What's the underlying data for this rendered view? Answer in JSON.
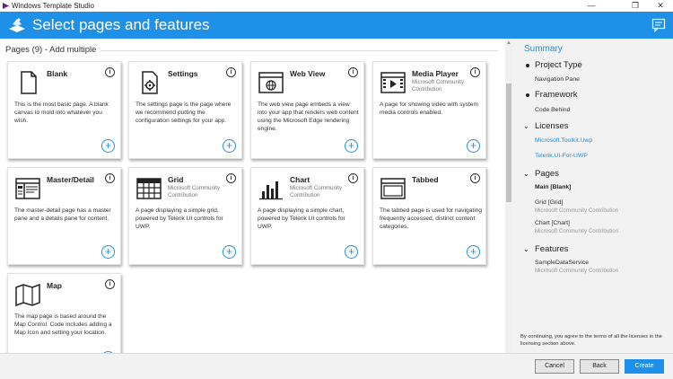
{
  "window": {
    "title": "Windows Template Studio",
    "controls": {
      "minimize": "—",
      "restore": "❐",
      "close": "✕"
    }
  },
  "header": {
    "title": "Select pages and features"
  },
  "section": {
    "title": "Pages (9) - Add multiple"
  },
  "cards": [
    {
      "name": "Blank",
      "sub": "",
      "icon": "blank-page-icon",
      "desc": "This is the most basic page. A blank canvas to mold into whatever you wish."
    },
    {
      "name": "Settings",
      "sub": "",
      "icon": "settings-gear-icon",
      "desc": "The settings page is the page where we recommend putting the configuration settings for your app."
    },
    {
      "name": "Web View",
      "sub": "",
      "icon": "web-view-globe-icon",
      "desc": "The web view page embeds a view into your app that renders web content using the Microsoft Edge rendering engine."
    },
    {
      "name": "Media Player",
      "sub": "Microsoft Community Contribution",
      "icon": "media-player-icon",
      "desc": "A page for showing video with system media controls enabled."
    },
    {
      "name": "Master/Detail",
      "sub": "",
      "icon": "master-detail-icon",
      "desc": "The master-detail page has a master pane and a details pane for content."
    },
    {
      "name": "Grid",
      "sub": "Microsoft Community Contribution",
      "icon": "grid-icon",
      "desc": "A page displaying a simple grid, powered by Telerik UI controls for UWP."
    },
    {
      "name": "Chart",
      "sub": "Microsoft Community Contribution",
      "icon": "chart-icon",
      "desc": "A page displaying a simple chart, powered by Telerik UI controls for UWP."
    },
    {
      "name": "Tabbed",
      "sub": "",
      "icon": "tabbed-icon",
      "desc": "The tabbed page is used for navigating frequently accessed, distinct content categories."
    },
    {
      "name": "Map",
      "sub": "",
      "icon": "map-icon",
      "desc": "The map page is based around the Map Control. Code includes adding a Map Icon and setting your location."
    }
  ],
  "summary": {
    "title": "Summary",
    "project_type_label": "Project Type",
    "project_type_value": "Navigation Pane",
    "framework_label": "Framework",
    "framework_value": "Code Behind",
    "licenses_label": "Licenses",
    "licenses": [
      "Microsoft.Toolkit.Uwp",
      "Telerik.UI-For-UWP"
    ],
    "pages_label": "Pages",
    "pages": [
      {
        "name": "Main [Blank]",
        "sub": ""
      },
      {
        "name": "Grid [Grid]",
        "sub": "Microsoft Community Contribution"
      },
      {
        "name": "Chart [Chart]",
        "sub": "Microsoft Community Contribution"
      }
    ],
    "features_label": "Features",
    "features": [
      {
        "name": "SampleDataService",
        "sub": "Microsoft Community Contribution"
      }
    ],
    "footer_text": "By continuing, you agree to the terms of all the licenses in the licensing section above."
  },
  "buttons": {
    "cancel": "Cancel",
    "back": "Back",
    "create": "Create"
  },
  "colors": {
    "accent": "#1e90e8",
    "summary_bg": "#f2f2f2"
  }
}
